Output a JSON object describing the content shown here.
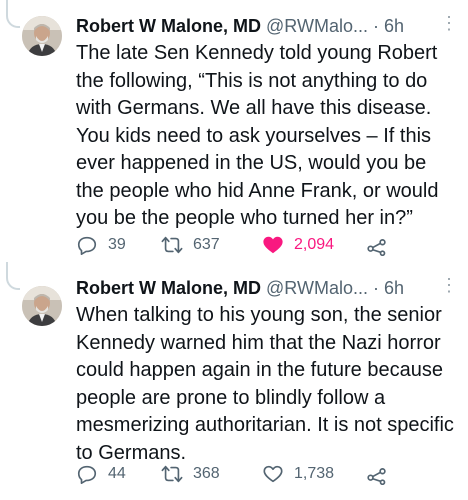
{
  "tweets": [
    {
      "name": "Robert W Malone, MD",
      "handle": "@RWMalo...",
      "separator": "·",
      "time": "6h",
      "text": "The late Sen Kennedy told young Robert the following, “This is not anything to do with Germans. We all have this disease. You kids need to ask yourselves – If this ever happened in the US, would you be the people who hid Anne Frank, or would you be the people who turned her in?”",
      "replies": "39",
      "retweets": "637",
      "likes": "2,094",
      "liked": true
    },
    {
      "name": "Robert W Malone, MD",
      "handle": "@RWMalo...",
      "separator": "·",
      "time": "6h",
      "text": "When talking to his young son, the senior Kennedy warned him that the Nazi horror could happen again in the future because people are prone to blindly follow a mesmerizing authoritarian. It is not specific to Germans.",
      "replies": "44",
      "retweets": "368",
      "likes": "1,738",
      "liked": false
    }
  ],
  "colors": {
    "text": "#0f1419",
    "muted": "#536471",
    "like_active": "#f91880",
    "thread_line": "#cfd9de"
  }
}
